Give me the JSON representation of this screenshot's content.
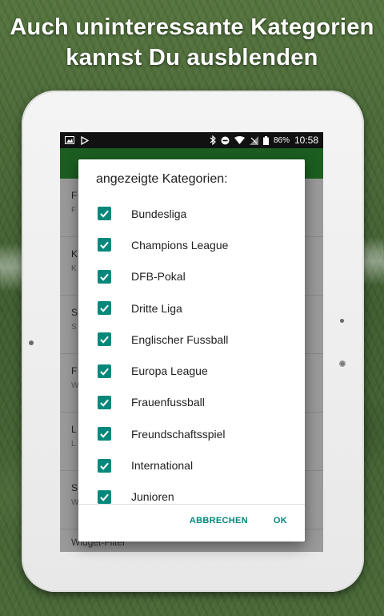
{
  "headline": {
    "line1": "Auch uninteressante Kategorien",
    "line2": "kannst Du ausblenden"
  },
  "statusbar": {
    "battery": "86%",
    "time": "10:58"
  },
  "background_rows": [
    {
      "title": "F",
      "sub": "F"
    },
    {
      "title": "K",
      "sub": "K"
    },
    {
      "title": "S",
      "sub": "S"
    },
    {
      "title": "F",
      "sub": "W"
    },
    {
      "title": "L",
      "sub": "L"
    },
    {
      "title": "S",
      "sub": "W"
    }
  ],
  "widget_filter": "Widget-Filter",
  "dialog": {
    "title": "angezeigte Kategorien:",
    "categories": [
      {
        "label": "Bundesliga",
        "checked": true
      },
      {
        "label": "Champions League",
        "checked": true
      },
      {
        "label": "DFB-Pokal",
        "checked": true
      },
      {
        "label": "Dritte Liga",
        "checked": true
      },
      {
        "label": "Englischer Fussball",
        "checked": true
      },
      {
        "label": "Europa League",
        "checked": true
      },
      {
        "label": "Frauenfussball",
        "checked": true
      },
      {
        "label": "Freundschaftsspiel",
        "checked": true
      },
      {
        "label": "International",
        "checked": true
      },
      {
        "label": "Junioren",
        "checked": true
      }
    ],
    "cancel_label": "ABBRECHEN",
    "ok_label": "OK"
  },
  "colors": {
    "accent": "#00897b",
    "appbar": "#1b5e20"
  }
}
